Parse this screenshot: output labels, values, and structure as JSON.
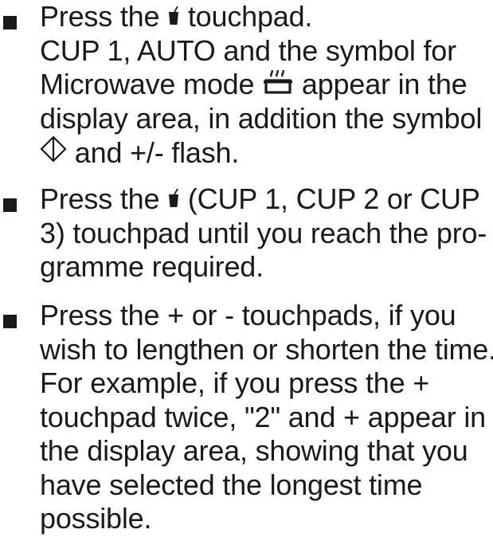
{
  "steps": [
    {
      "lines": [
        [
          "Press the ",
          {
            "icon": "cup-icon"
          },
          " touchpad."
        ],
        [
          "CUP 1, AUTO and the symbol for"
        ],
        [
          "Microwave mode ",
          {
            "icon": "microwave-mode-icon"
          },
          " appear in the"
        ],
        [
          "display area, in addition the symbol"
        ],
        [
          {
            "icon": "start-diamond-icon"
          },
          " and +/- flash."
        ]
      ]
    },
    {
      "lines": [
        [
          "Press the ",
          {
            "icon": "cup-icon"
          },
          " (CUP 1, CUP 2 or CUP"
        ],
        [
          "3) touchpad until you reach the pro-"
        ],
        [
          "gramme required."
        ]
      ]
    },
    {
      "lines": [
        [
          "Press the + or - touchpads, if you"
        ],
        [
          "wish to lengthen or shorten the time."
        ],
        [
          "For example, if you press the +"
        ],
        [
          "touchpad twice, \"2\" and + appear in"
        ],
        [
          "the display area, showing that you"
        ],
        [
          "have selected the longest time"
        ],
        [
          "possible."
        ]
      ]
    }
  ],
  "colors": {
    "text": "#1a1a1a",
    "background": "#ffffff"
  }
}
